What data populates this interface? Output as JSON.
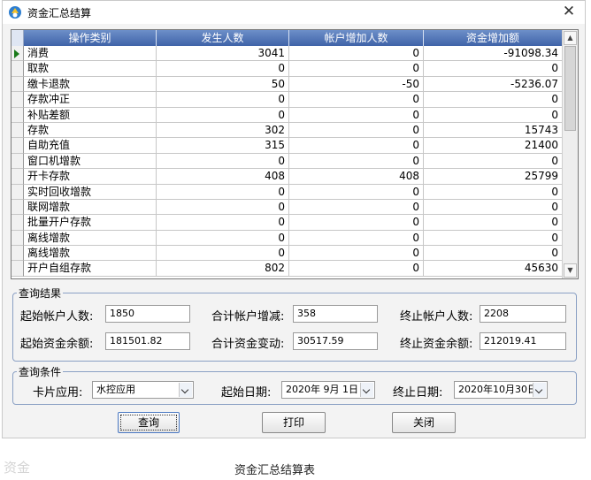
{
  "window": {
    "title": "资金汇总结算",
    "close_glyph": "✕"
  },
  "grid": {
    "columns": [
      "操作类别",
      "发生人数",
      "帐户增加人数",
      "资金增加额"
    ],
    "rows": [
      {
        "category": "消费",
        "count": "3041",
        "account_added": "0",
        "amount_added": "-91098.34"
      },
      {
        "category": "取款",
        "count": "0",
        "account_added": "0",
        "amount_added": "0"
      },
      {
        "category": "缴卡退款",
        "count": "50",
        "account_added": "-50",
        "amount_added": "-5236.07"
      },
      {
        "category": "存款冲正",
        "count": "0",
        "account_added": "0",
        "amount_added": "0"
      },
      {
        "category": "补贴差额",
        "count": "0",
        "account_added": "0",
        "amount_added": "0"
      },
      {
        "category": "存款",
        "count": "302",
        "account_added": "0",
        "amount_added": "15743"
      },
      {
        "category": "自助充值",
        "count": "315",
        "account_added": "0",
        "amount_added": "21400"
      },
      {
        "category": "窗口机增款",
        "count": "0",
        "account_added": "0",
        "amount_added": "0"
      },
      {
        "category": "开卡存款",
        "count": "408",
        "account_added": "408",
        "amount_added": "25799"
      },
      {
        "category": "实时回收增款",
        "count": "0",
        "account_added": "0",
        "amount_added": "0"
      },
      {
        "category": "联网增款",
        "count": "0",
        "account_added": "0",
        "amount_added": "0"
      },
      {
        "category": "批量开户存款",
        "count": "0",
        "account_added": "0",
        "amount_added": "0"
      },
      {
        "category": "离线增款",
        "count": "0",
        "account_added": "0",
        "amount_added": "0"
      },
      {
        "category": "离线增款",
        "count": "0",
        "account_added": "0",
        "amount_added": "0"
      },
      {
        "category": "开户自组存款",
        "count": "802",
        "account_added": "0",
        "amount_added": "45630"
      }
    ]
  },
  "result": {
    "legend": "查询结果",
    "start_accounts_label": "起始帐户人数:",
    "start_accounts_value": "1850",
    "total_account_change_label": "合计帐户增减:",
    "total_account_change_value": "358",
    "end_accounts_label": "终止帐户人数:",
    "end_accounts_value": "2208",
    "start_balance_label": "起始资金余额:",
    "start_balance_value": "181501.82",
    "total_fund_change_label": "合计资金变动:",
    "total_fund_change_value": "30517.59",
    "end_balance_label": "终止资金余额:",
    "end_balance_value": "212019.41"
  },
  "query": {
    "legend": "查询条件",
    "card_app_label": "卡片应用:",
    "card_app_value": "水控应用",
    "start_date_label": "起始日期:",
    "start_date_value": "2020年 9月 1日",
    "end_date_label": "终止日期:",
    "end_date_value": "2020年10月30日"
  },
  "buttons": {
    "query": "查询",
    "print": "打印",
    "close": "关闭"
  },
  "captions": {
    "left": "资金",
    "center": "资金汇总结算表"
  }
}
